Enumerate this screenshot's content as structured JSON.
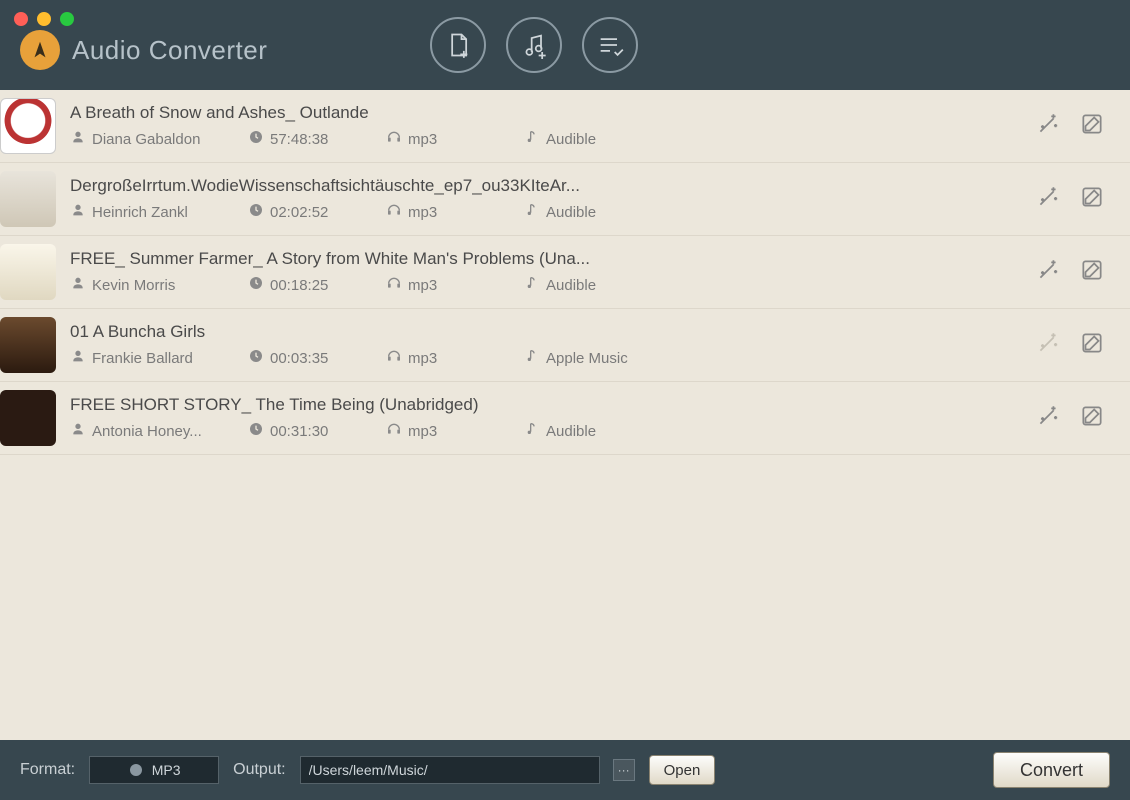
{
  "appTitle": "Audio Converter",
  "toolbar": {
    "addFile": "add-file",
    "addMusic": "add-music",
    "listCheck": "list-check"
  },
  "tracks": [
    {
      "title": "A Breath of Snow and Ashes_ Outlande",
      "artist": "Diana Gabaldon",
      "duration": "57:48:38",
      "format": "mp3",
      "source": "Audible",
      "wandDim": false
    },
    {
      "title": "DergroßeIrrtum.WodieWissenschaftsichtäuschte_ep7_ou33KIteAr...",
      "artist": "Heinrich Zankl",
      "duration": "02:02:52",
      "format": "mp3",
      "source": "Audible",
      "wandDim": false
    },
    {
      "title": "FREE_ Summer Farmer_ A Story from White Man's Problems (Una...",
      "artist": "Kevin Morris",
      "duration": "00:18:25",
      "format": "mp3",
      "source": "Audible",
      "wandDim": false
    },
    {
      "title": "01 A Buncha Girls",
      "artist": "Frankie Ballard",
      "duration": "00:03:35",
      "format": "mp3",
      "source": "Apple Music",
      "wandDim": true
    },
    {
      "title": "FREE SHORT STORY_ The Time Being (Unabridged)",
      "artist": "Antonia Honey...",
      "duration": "00:31:30",
      "format": "mp3",
      "source": "Audible",
      "wandDim": false
    }
  ],
  "footer": {
    "formatLabel": "Format:",
    "formatValue": "MP3",
    "outputLabel": "Output:",
    "outputPath": "/Users/leem/Music/",
    "more": "···",
    "openLabel": "Open",
    "convertLabel": "Convert"
  }
}
